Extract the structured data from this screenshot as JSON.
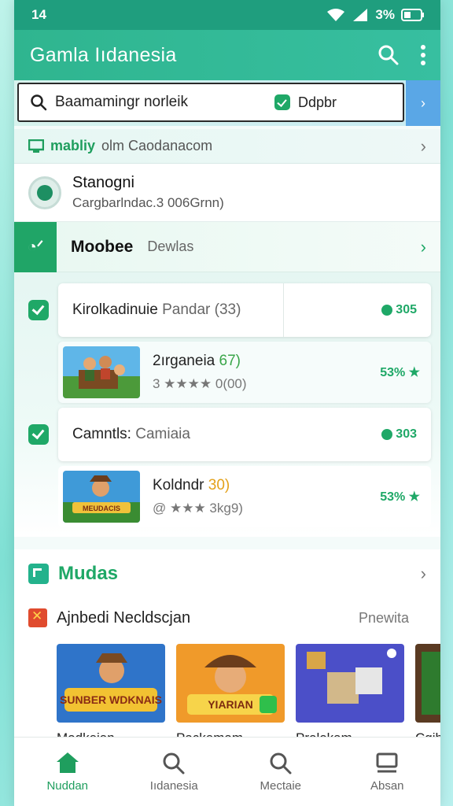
{
  "status": {
    "time": "14",
    "battery": "3%"
  },
  "appbar": {
    "title": "Gamla Iıdanesia"
  },
  "search": {
    "text": "Baamamingr norleik",
    "filter_label": "Ddpbr"
  },
  "source": {
    "label": "mabliy",
    "host": "olm Caodanacom"
  },
  "profile": {
    "name": "Stanogni",
    "subtitle": "Cargbarlndac.3 006Grnn)"
  },
  "category": {
    "title": "Moobee",
    "subtitle": "Dewlas"
  },
  "list_rows": [
    {
      "title": "Kirolkadinuie",
      "muted": "Pandar (33)",
      "badge": "305"
    },
    {
      "title": "Camntls:",
      "muted": "Camiaia",
      "badge": "303"
    }
  ],
  "games": [
    {
      "title": "2ırganeia",
      "accent": "67)",
      "rating": "3 ★★★★ 0(00)",
      "pct": "53% ★"
    },
    {
      "title": "Koldndr",
      "accent": "30)",
      "rating": "@ ★★★ 3kg9)",
      "pct": "53% ★"
    }
  ],
  "section": {
    "title": "Mudas"
  },
  "recommend": {
    "title": "Ajnbedi Necldscjan",
    "link": "Pnewita"
  },
  "cards": [
    {
      "label": "Modkeian",
      "art_text": "SUNBER WDKNAIS"
    },
    {
      "label": "Packemam",
      "art_text": "YIARIAN"
    },
    {
      "label": "Prolokam",
      "art_text": ""
    },
    {
      "label": "Cgjh",
      "art_text": ""
    }
  ],
  "nav": [
    {
      "label": "Nuddan",
      "icon": "home-icon",
      "active": true
    },
    {
      "label": "Iıdanesia",
      "icon": "search-icon",
      "active": false
    },
    {
      "label": "Mectaie",
      "icon": "search-icon",
      "active": false
    },
    {
      "label": "Absan",
      "icon": "inbox-icon",
      "active": false
    }
  ],
  "colors": {
    "primary": "#2fb58f",
    "accent_green": "#1fa867",
    "status_bar": "#1f9e7e"
  }
}
